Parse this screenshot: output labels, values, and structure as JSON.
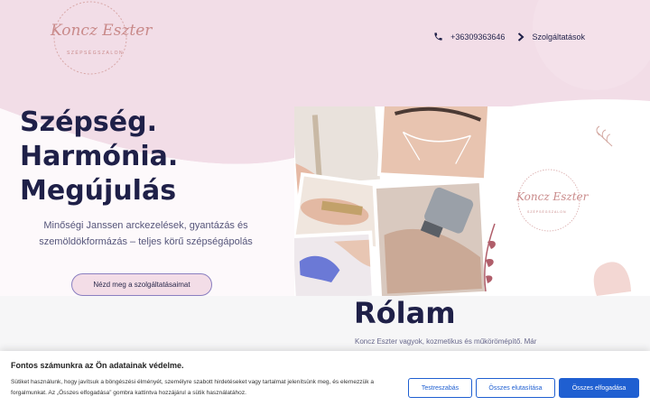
{
  "logo": {
    "script": "Koncz Eszter",
    "subtitle": "SZÉPSÉGSZALON"
  },
  "nav": {
    "phone_icon": "phone-icon",
    "phone": "+36309363646",
    "services_icon": "chevron-right-icon",
    "services": "Szolgáltatások"
  },
  "hero": {
    "line1": "Szépség.",
    "line2": "Harmónia.",
    "line3": "Megújulás",
    "description": "Minőségi Janssen arckezelések, gyantázás és szemöldökformázás – teljes körű szépségápolás",
    "cta": "Nézd meg a szolgáltatásaimat"
  },
  "collage": {
    "logo_script": "Koncz Eszter",
    "logo_subtitle": "SZÉPSÉGSZALON"
  },
  "about": {
    "title": "Rólam",
    "text": "Koncz Eszter vagyok, kozmetikus és műkörömépítő. Már"
  },
  "cookie": {
    "title": "Fontos számunkra az Ön adatainak védelme.",
    "text": "Sütiket használunk, hogy javítsuk a böngészési élményét, személyre szabott hirdetéseket vagy tartalmat jelenítsünk meg, és elemezzük a forgalmunkat. Az „Összes elfogadása” gombra kattintva hozzájárul a sütik használatához.",
    "settings": "Testreszabás",
    "reject": "Összes elutasítása",
    "accept": "Összes elfogadása"
  },
  "colors": {
    "navy": "#1f2048",
    "pink_bg": "#f2dde7",
    "blue_button": "#1f5fd1",
    "rose_gold": "#c98a8a"
  }
}
